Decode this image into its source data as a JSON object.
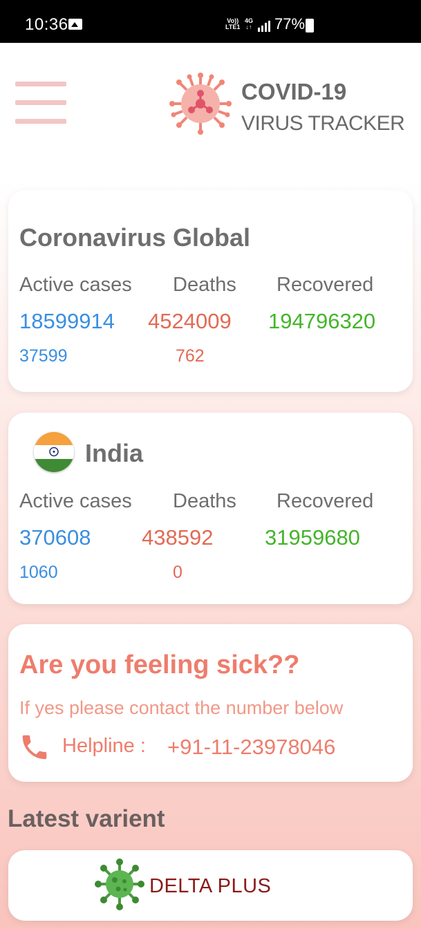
{
  "status_bar": {
    "time": "10:36",
    "volte_line1": "Vo))",
    "volte_line2": "LTE1",
    "network_line1": "4G",
    "network_line2": "↓↑",
    "battery": "77%",
    "icons": [
      "image-icon",
      "signal-icon",
      "battery-charging-icon"
    ]
  },
  "header": {
    "title_line1": "COVID-19",
    "title_line2": "VIRUS TRACKER",
    "menu_icon": "hamburger-menu-icon",
    "logo_icon": "virus-logo-icon"
  },
  "global": {
    "title": "Coronavirus Global",
    "labels": {
      "active": "Active cases",
      "deaths": "Deaths",
      "recovered": "Recovered"
    },
    "active": "18599914",
    "deaths": "4524009",
    "recovered": "194796320",
    "active_new": "37599",
    "deaths_new": "762"
  },
  "india": {
    "title": "India",
    "flag_icon": "india-flag-icon",
    "labels": {
      "active": "Active cases",
      "deaths": "Deaths",
      "recovered": "Recovered"
    },
    "active": "370608",
    "deaths": "438592",
    "recovered": "31959680",
    "active_new": "1060",
    "deaths_new": "0"
  },
  "sick": {
    "title": "Are you feeling sick??",
    "subtitle": "If yes please contact the number below",
    "helpline_label": "Helpline :",
    "helpline_number": "+91-11-23978046",
    "phone_icon": "phone-icon"
  },
  "variant": {
    "section_title": "Latest varient",
    "name": "DELTA PLUS",
    "icon": "virus-green-icon"
  },
  "colors": {
    "active": "#3a8fe0",
    "deaths": "#e26a55",
    "recovered": "#44b52a",
    "accent": "#ee7d6c",
    "variant_text": "#8b1a1a"
  }
}
